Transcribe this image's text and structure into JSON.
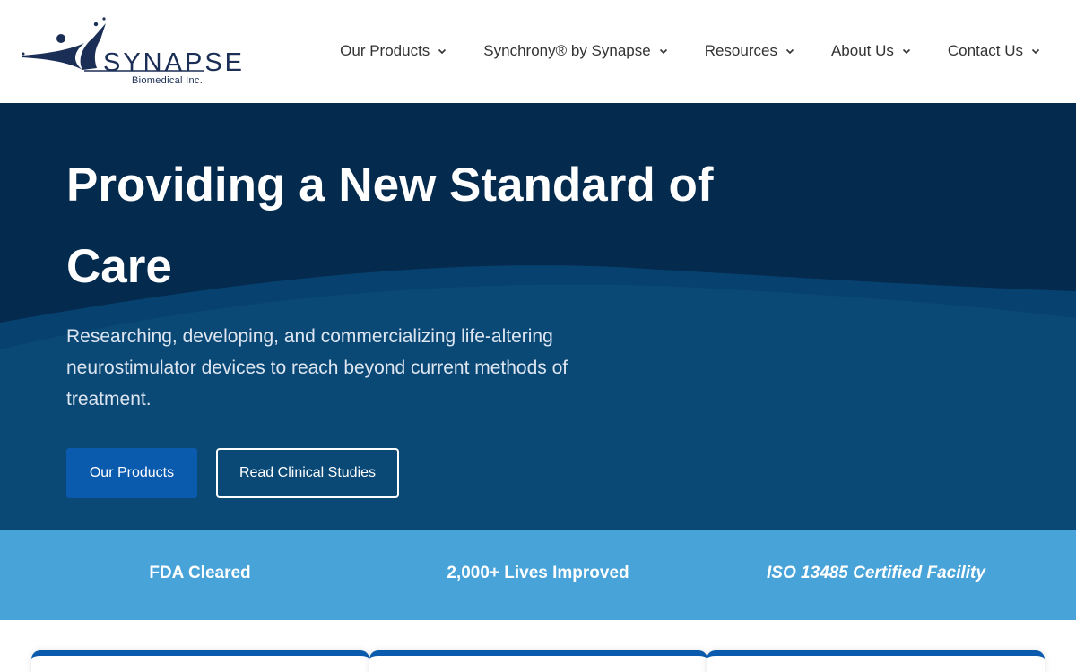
{
  "brand": {
    "name": "SYNAPSE",
    "subtitle": "Biomedical Inc.",
    "primary_color": "#1b2f56",
    "accent_color": "#0a5aad"
  },
  "nav": {
    "items": [
      {
        "label": "Our Products",
        "icon": "chevron-down-icon"
      },
      {
        "label": "Synchrony® by Synapse",
        "icon": "chevron-down-icon"
      },
      {
        "label": "Resources",
        "icon": "chevron-down-icon"
      },
      {
        "label": "About Us",
        "icon": "chevron-down-icon"
      },
      {
        "label": "Contact Us",
        "icon": "chevron-down-icon"
      }
    ]
  },
  "hero": {
    "title": "Providing a New Standard of Care",
    "subtitle": "Researching, developing, and commercializing life-altering neurostimulator devices to reach beyond current methods of treatment.",
    "primary_button": "Our Products",
    "secondary_button": "Read Clinical Studies",
    "background_color": "#042a4e"
  },
  "stats": {
    "background_color": "#48a3d9",
    "items": [
      {
        "label": "FDA Cleared"
      },
      {
        "label": "2,000+ Lives Improved"
      },
      {
        "label": "ISO 13485 Certified Facility"
      }
    ]
  }
}
